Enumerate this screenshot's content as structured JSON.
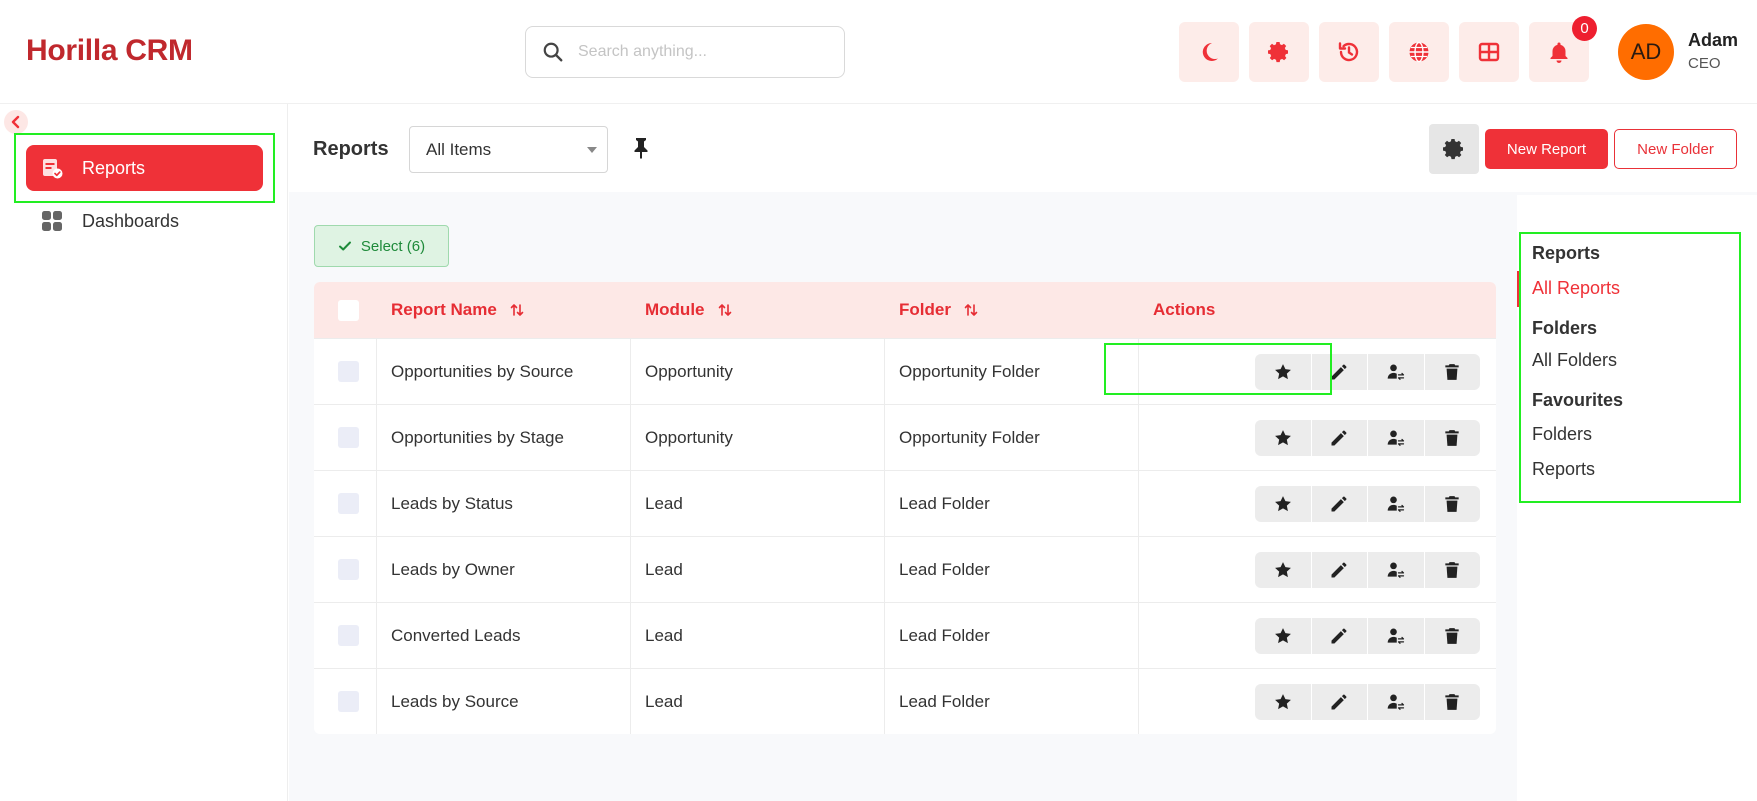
{
  "app": {
    "name": "Horilla CRM"
  },
  "search": {
    "placeholder": "Search anything..."
  },
  "header": {
    "notification_count": "0"
  },
  "user": {
    "initials": "AD",
    "name": "Adam",
    "role": "CEO"
  },
  "sidebar": {
    "items": [
      {
        "label": "Reports",
        "icon": "report-icon",
        "active": true
      },
      {
        "label": "Dashboards",
        "icon": "grid-icon",
        "active": false
      }
    ]
  },
  "toolbar": {
    "title": "Reports",
    "filter_value": "All Items",
    "new_report_label": "New Report",
    "new_folder_label": "New Folder"
  },
  "selection": {
    "label": "Select (6)"
  },
  "table": {
    "headers": {
      "name": "Report Name",
      "module": "Module",
      "folder": "Folder",
      "actions": "Actions"
    },
    "rows": [
      {
        "name": "Opportunities by Source",
        "module": "Opportunity",
        "folder": "Opportunity Folder"
      },
      {
        "name": "Opportunities by Stage",
        "module": "Opportunity",
        "folder": "Opportunity Folder"
      },
      {
        "name": "Leads by Status",
        "module": "Lead",
        "folder": "Lead Folder"
      },
      {
        "name": "Leads by Owner",
        "module": "Lead",
        "folder": "Lead Folder"
      },
      {
        "name": "Converted Leads",
        "module": "Lead",
        "folder": "Lead Folder"
      },
      {
        "name": "Leads by Source",
        "module": "Lead",
        "folder": "Lead Folder"
      }
    ]
  },
  "right_panel": {
    "reports_heading": "Reports",
    "all_reports": "All Reports",
    "folders_heading": "Folders",
    "all_folders": "All Folders",
    "favourites_heading": "Favourites",
    "fav_folders": "Folders",
    "fav_reports": "Reports"
  },
  "colors": {
    "brand": "#c0282d",
    "accent": "#ef3138",
    "highlight": "#22ee22"
  }
}
